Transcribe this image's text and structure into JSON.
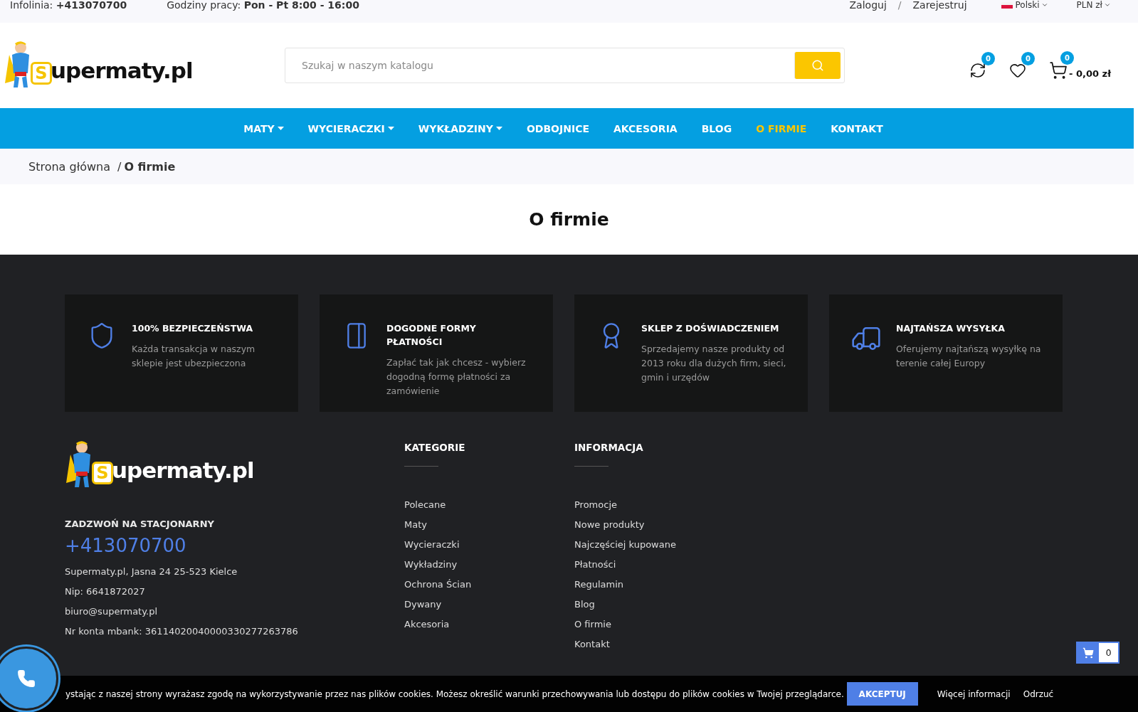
{
  "top_bar": {
    "hotline_label": "Infolinia:",
    "hotline": "+413070700",
    "hours_label": "Godziny pracy:",
    "hours": "Pon - Pt 8:00 - 16:00",
    "login": "Zaloguj",
    "separator": "/",
    "register": "Zarejestruj",
    "language": "Polski",
    "currency": "PLN zł"
  },
  "header": {
    "logo": {
      "letter": "S",
      "text": "upermaty.pl"
    },
    "search": {
      "placeholder": "Szukaj w naszym katalogu"
    },
    "compare_count": "0",
    "wishlist_count": "0",
    "cart_count": "0",
    "cart_total": "- 0,00 zł"
  },
  "nav": [
    {
      "label": "MATY",
      "dropdown": true,
      "selected": false
    },
    {
      "label": "WYCIERACZKI",
      "dropdown": true,
      "selected": false
    },
    {
      "label": "WYKŁADZINY",
      "dropdown": true,
      "selected": false
    },
    {
      "label": "ODBOJNICE",
      "dropdown": false,
      "selected": false
    },
    {
      "label": "AKCESORIA",
      "dropdown": false,
      "selected": false
    },
    {
      "label": "BLOG",
      "dropdown": false,
      "selected": false
    },
    {
      "label": "O FIRMIE",
      "dropdown": false,
      "selected": true
    },
    {
      "label": "KONTAKT",
      "dropdown": false,
      "selected": false
    }
  ],
  "breadcrumb": {
    "home": "Strona główna",
    "separator": "/",
    "current": "O firmie"
  },
  "page_title": "O firmie",
  "features": [
    {
      "kind": "shield",
      "title": "100% BEZPIECZEŃSTWA",
      "text": "Każda transakcja w naszym sklepie jest ubezpieczona"
    },
    {
      "kind": "card",
      "title": "DOGODNE FORMY PŁATNOŚCI",
      "text": "Zapłać tak jak chcesz - wybierz dogodną formę płatności za zamówienie"
    },
    {
      "kind": "award",
      "title": "SKLEP Z DOŚWIADCZENIEM",
      "text": "Sprzedajemy nasze produkty od 2013 roku dla dużych firm, sieci, gmin i urzędów"
    },
    {
      "kind": "truck",
      "title": "NAJTAŃSZA WYSYŁKA",
      "text": "Oferujemy najtańszą wysyłkę na terenie całej Europy"
    }
  ],
  "footer": {
    "logo": {
      "letter": "S",
      "text": "upermaty.pl"
    },
    "call_heading": "ZADZWOŃ NA STACJONARNY",
    "phone": "+413070700",
    "address": "Supermaty.pl, Jasna 24 25-523 Kielce",
    "nip": "Nip: 6641872027",
    "email": "biuro@supermaty.pl",
    "bank": "Nr konta mbank: 36114020040000330277263786",
    "columns": [
      {
        "title": "KATEGORIE",
        "links": [
          "Polecane",
          "Maty",
          "Wycieraczki",
          "Wykładziny",
          "Ochrona Ścian",
          "Dywany",
          "Akcesoria"
        ]
      },
      {
        "title": "INFORMACJA",
        "links": [
          "Promocje",
          "Nowe produkty",
          "Najczęściej kupowane",
          "Płatności",
          "Regulamin",
          "Blog",
          "O firmie",
          "Kontakt"
        ]
      }
    ]
  },
  "cookie_bar": {
    "text": "ystając z naszej strony wyrażasz zgodę na wykorzystywanie przez nas plików cookies. Możesz określić warunki przechowywania lub dostępu do plików cookies w Twojej przeglądarce.",
    "accept": "AKCEPTUJ",
    "more": "Więcej informacji",
    "reject": "Odrzuć"
  },
  "floating_cart": {
    "count": "0"
  }
}
